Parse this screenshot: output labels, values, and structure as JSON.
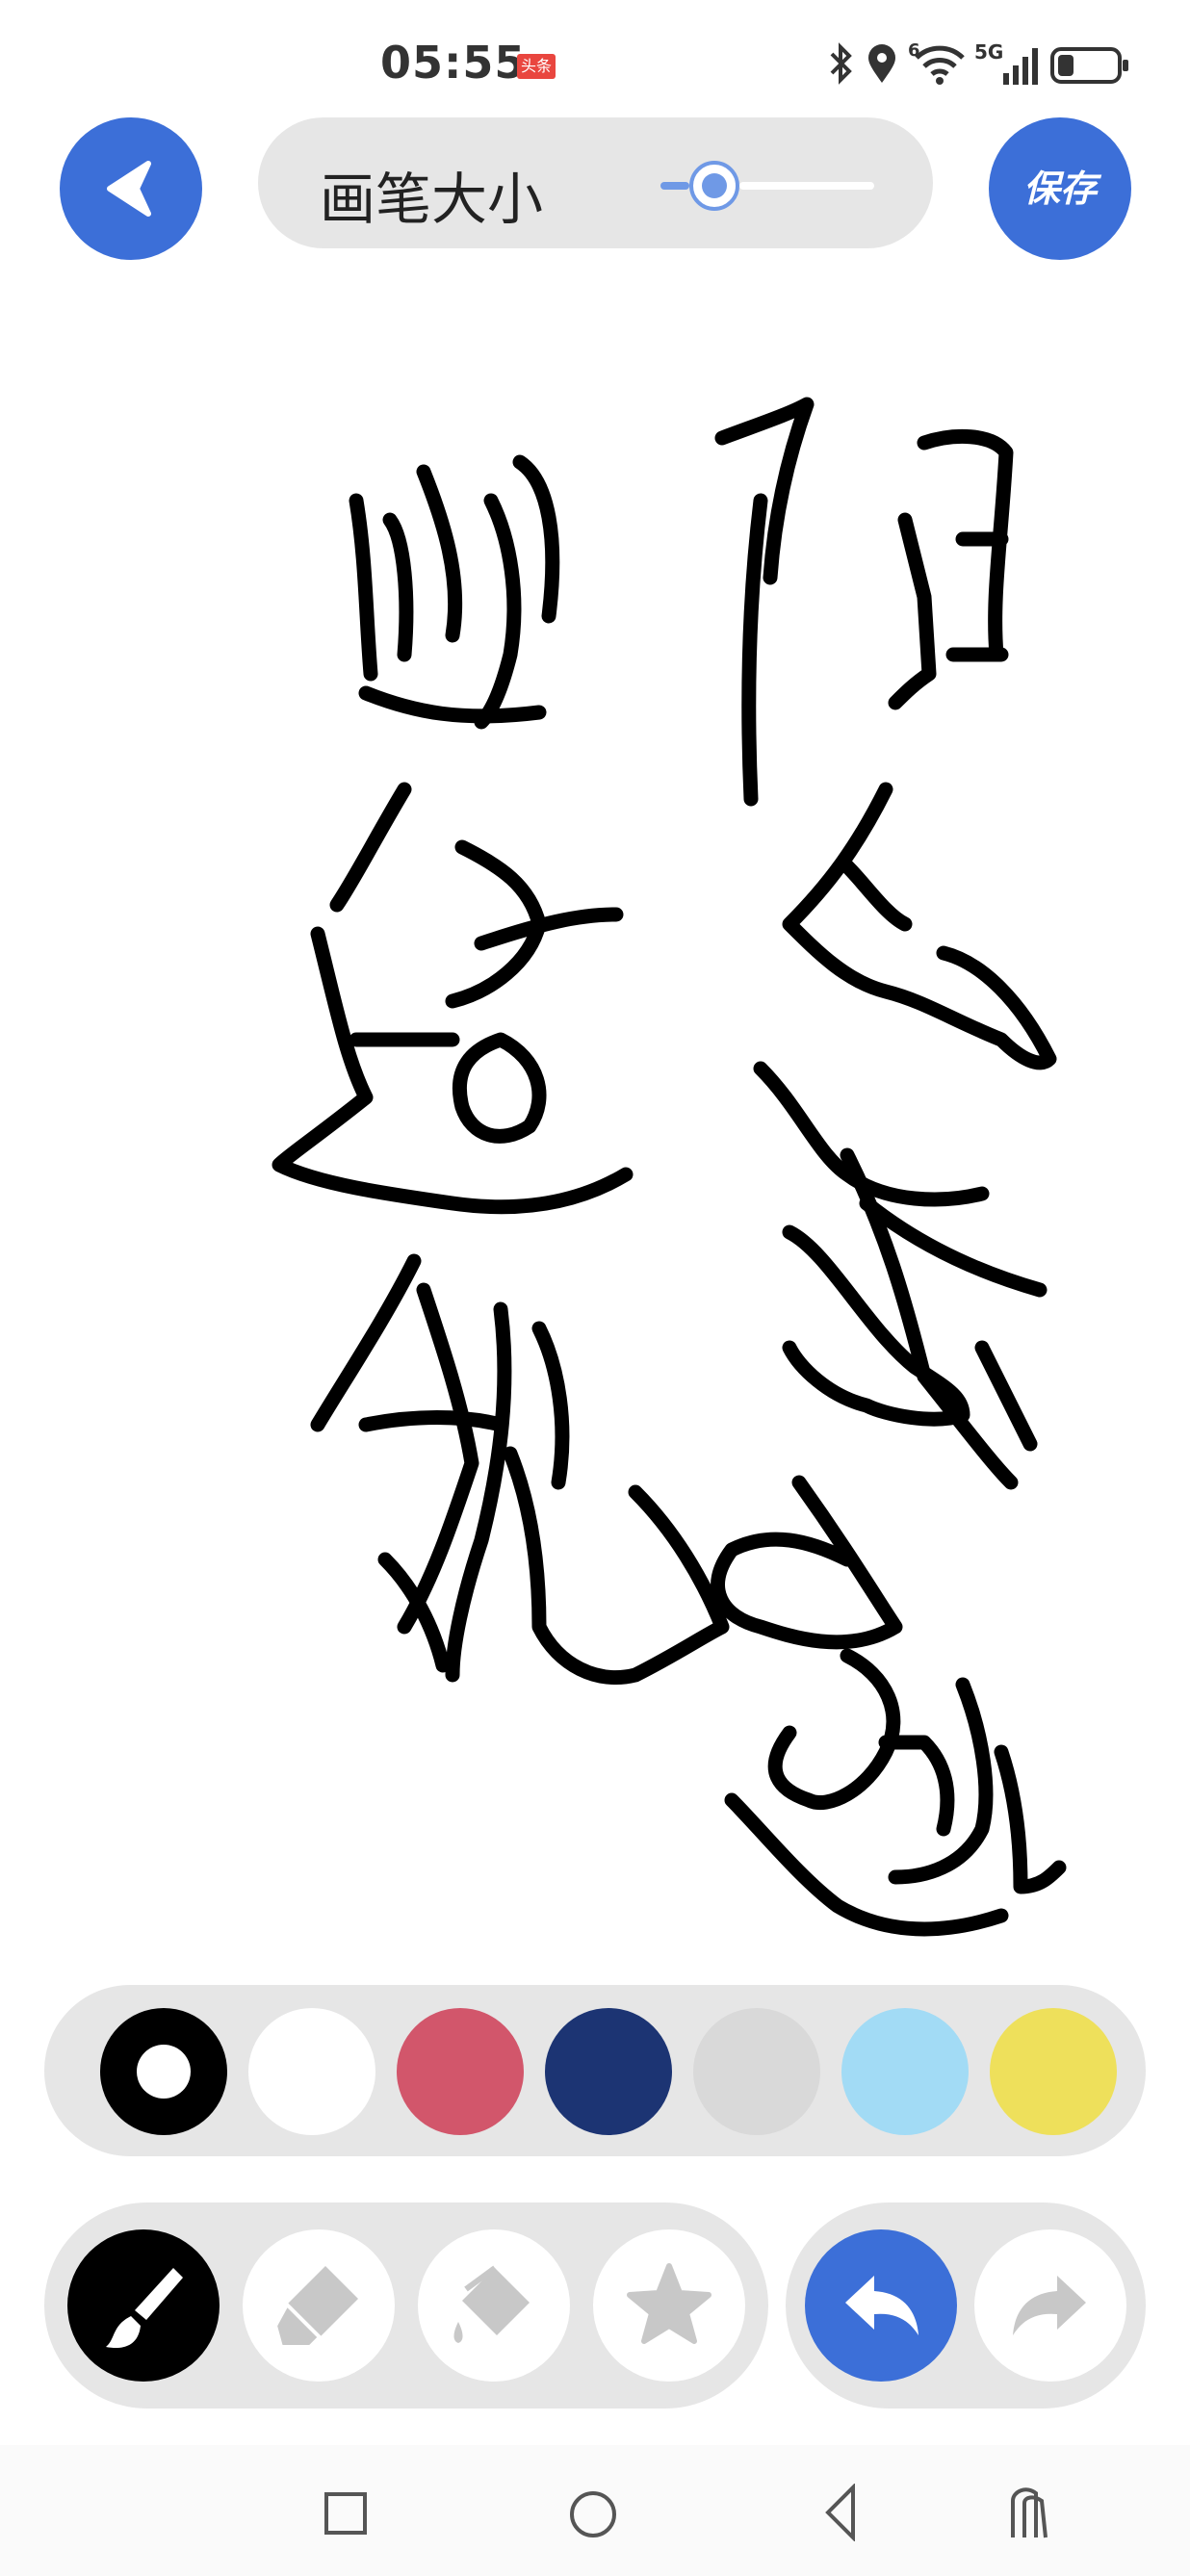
{
  "status_bar": {
    "time": "05:55",
    "app_badge": "头条",
    "network": "5G",
    "wifi_badge": "6"
  },
  "toolbar": {
    "back_icon": "back-arrow-icon",
    "brush_size_label": "画笔大小",
    "brush_size_level": 0.15,
    "save_label": "保存"
  },
  "palette": {
    "colors": [
      "#000000",
      "#ffffff",
      "#d2566b",
      "#1c3473",
      "#d9d9d9",
      "#a2dbf5",
      "#eee05b"
    ],
    "selected_index": 0
  },
  "tools": {
    "items": [
      "brush-icon",
      "eraser-icon",
      "fill-bucket-icon",
      "sticker-star-icon"
    ],
    "active": "brush-icon",
    "undo_icon": "undo-icon",
    "redo_icon": "redo-icon",
    "accent": "#3c6fd8"
  },
  "nav_bar": {
    "icons": [
      "recent-apps-square-icon",
      "home-circle-icon",
      "back-triangle-icon",
      "accessibility-icon"
    ]
  }
}
